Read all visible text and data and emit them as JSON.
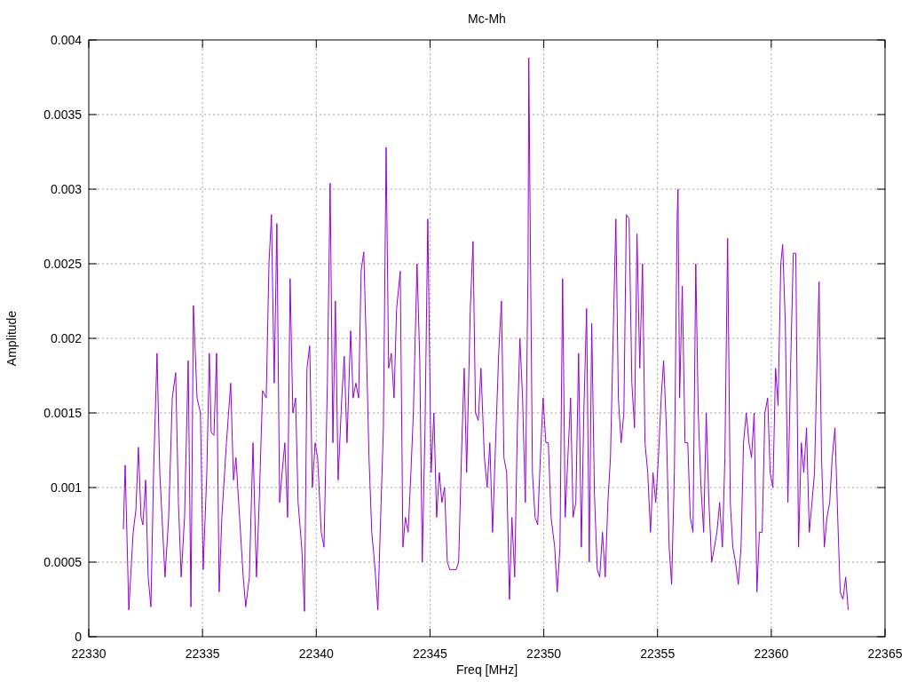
{
  "chart_data": {
    "type": "line",
    "title": "Mc-Mh",
    "grid": true,
    "xlabel": "Freq [MHz]",
    "ylabel": "Amplitude",
    "xlim": [
      22330,
      22365
    ],
    "ylim": [
      0,
      0.004
    ],
    "xticks": [
      22330,
      22335,
      22340,
      22345,
      22350,
      22355,
      22360,
      22365
    ],
    "yticks": [
      0,
      0.0005,
      0.001,
      0.0015,
      0.002,
      0.0025,
      0.003,
      0.0035,
      0.004
    ],
    "x": [
      22331.52,
      22331.6,
      22331.76,
      22331.95,
      22332.07,
      22332.18,
      22332.3,
      22332.38,
      22332.5,
      22332.61,
      22332.73,
      22332.85,
      22333.0,
      22333.12,
      22333.35,
      22333.51,
      22333.67,
      22333.82,
      22333.94,
      22334.06,
      22334.21,
      22334.37,
      22334.49,
      22334.6,
      22334.76,
      22334.91,
      22335.03,
      22335.19,
      22335.3,
      22335.38,
      22335.5,
      22335.62,
      22335.73,
      22335.85,
      22336.05,
      22336.24,
      22336.36,
      22336.47,
      22336.63,
      22336.79,
      22336.9,
      22337.06,
      22337.22,
      22337.37,
      22337.49,
      22337.64,
      22337.8,
      22337.92,
      22338.03,
      22338.15,
      22338.27,
      22338.39,
      22338.5,
      22338.62,
      22338.74,
      22338.85,
      22338.97,
      22339.09,
      22339.2,
      22339.36,
      22339.48,
      22339.59,
      22339.71,
      22339.83,
      22339.95,
      22340.06,
      22340.22,
      22340.34,
      22340.49,
      22340.61,
      22340.73,
      22340.84,
      22340.96,
      22341.12,
      22341.23,
      22341.35,
      22341.51,
      22341.62,
      22341.74,
      22341.86,
      22341.97,
      22342.09,
      22342.21,
      22342.32,
      22342.44,
      22342.56,
      22342.71,
      22342.83,
      22342.95,
      22343.07,
      22343.18,
      22343.3,
      22343.42,
      22343.53,
      22343.69,
      22343.81,
      22343.92,
      22344.04,
      22344.16,
      22344.27,
      22344.43,
      22344.55,
      22344.66,
      22344.78,
      22344.9,
      22345.05,
      22345.17,
      22345.29,
      22345.41,
      22345.52,
      22345.64,
      22345.76,
      22345.87,
      22345.99,
      22346.15,
      22346.26,
      22346.38,
      22346.5,
      22346.61,
      22346.77,
      22346.89,
      22347.0,
      22347.12,
      22347.24,
      22347.39,
      22347.51,
      22347.63,
      22347.75,
      22347.86,
      22348.02,
      22348.14,
      22348.25,
      22348.37,
      22348.49,
      22348.6,
      22348.72,
      22348.84,
      22348.95,
      22349.07,
      22349.19,
      22349.31,
      22349.34,
      22349.42,
      22349.5,
      22349.62,
      22349.73,
      22349.85,
      22349.97,
      22350.09,
      22350.2,
      22350.32,
      22350.48,
      22350.59,
      22350.71,
      22350.83,
      22350.94,
      22351.06,
      22351.18,
      22351.29,
      22351.41,
      22351.53,
      22351.65,
      22351.76,
      22351.88,
      22352.0,
      22352.11,
      22352.23,
      22352.35,
      22352.46,
      22352.58,
      22352.7,
      22352.82,
      22352.93,
      22353.05,
      22353.17,
      22353.28,
      22353.4,
      22353.52,
      22353.63,
      22353.75,
      22353.87,
      22353.99,
      22354.1,
      22354.22,
      22354.34,
      22354.45,
      22354.57,
      22354.69,
      22354.8,
      22354.92,
      22355.04,
      22355.16,
      22355.27,
      22355.39,
      22355.51,
      22355.62,
      22355.74,
      22355.86,
      22355.9,
      22355.97,
      22356.09,
      22356.21,
      22356.33,
      22356.44,
      22356.56,
      22356.68,
      22356.79,
      22356.91,
      22357.03,
      22357.14,
      22357.26,
      22357.38,
      22357.5,
      22357.61,
      22357.73,
      22357.85,
      22357.96,
      22358.08,
      22358.2,
      22358.31,
      22358.43,
      22358.55,
      22358.67,
      22358.78,
      22358.9,
      22359.02,
      22359.13,
      22359.25,
      22359.37,
      22359.48,
      22359.6,
      22359.72,
      22359.84,
      22359.95,
      22360.07,
      22360.19,
      22360.3,
      22360.42,
      22360.5,
      22360.62,
      22360.73,
      22360.85,
      22360.97,
      22361.08,
      22361.2,
      22361.32,
      22361.43,
      22361.55,
      22361.67,
      22361.79,
      22361.9,
      22362.02,
      22362.1,
      22362.21,
      22362.33,
      22362.45,
      22362.57,
      22362.68,
      22362.8,
      22362.92,
      22363.03,
      22363.15,
      22363.27,
      22363.38
    ],
    "series": [
      {
        "color": "#9400d3",
        "values": [
          0.00072,
          0.00115,
          0.00018,
          0.0007,
          0.00085,
          0.00127,
          0.0008,
          0.00075,
          0.00105,
          0.0004,
          0.0002,
          0.0011,
          0.0019,
          0.0011,
          0.0004,
          0.0008,
          0.0016,
          0.00177,
          0.0009,
          0.0004,
          0.0008,
          0.00185,
          0.0002,
          0.00222,
          0.0016,
          0.0015,
          0.00045,
          0.0011,
          0.0019,
          0.00137,
          0.00135,
          0.0019,
          0.0003,
          0.0008,
          0.0013,
          0.0017,
          0.00105,
          0.0012,
          0.0008,
          0.0004,
          0.0002,
          0.0004,
          0.0013,
          0.0004,
          0.0009,
          0.00165,
          0.0016,
          0.0025,
          0.00283,
          0.0017,
          0.00277,
          0.0009,
          0.0011,
          0.0013,
          0.0008,
          0.0024,
          0.0015,
          0.0016,
          0.0009,
          0.0006,
          0.00017,
          0.0018,
          0.00195,
          0.001,
          0.0013,
          0.0012,
          0.0007,
          0.0006,
          0.0017,
          0.00304,
          0.0013,
          0.00225,
          0.00105,
          0.0016,
          0.00188,
          0.0013,
          0.00205,
          0.0016,
          0.0017,
          0.0016,
          0.00245,
          0.00258,
          0.0019,
          0.0012,
          0.0007,
          0.0005,
          0.00018,
          0.0008,
          0.0014,
          0.00328,
          0.0018,
          0.0019,
          0.0016,
          0.0022,
          0.00245,
          0.0006,
          0.0008,
          0.0007,
          0.0011,
          0.0015,
          0.0025,
          0.00185,
          0.0005,
          0.0014,
          0.0028,
          0.0011,
          0.0015,
          0.0008,
          0.0011,
          0.0009,
          0.001,
          0.0005,
          0.00045,
          0.00045,
          0.00045,
          0.0005,
          0.0012,
          0.0018,
          0.0011,
          0.0022,
          0.00265,
          0.0015,
          0.00145,
          0.0018,
          0.0012,
          0.001,
          0.0013,
          0.0007,
          0.0012,
          0.0019,
          0.00225,
          0.0012,
          0.0011,
          0.00025,
          0.0008,
          0.0004,
          0.0014,
          0.002,
          0.0016,
          0.0009,
          0.0025,
          0.00388,
          0.0025,
          0.0011,
          0.0008,
          0.00075,
          0.0012,
          0.0016,
          0.0013,
          0.0013,
          0.0008,
          0.0006,
          0.0003,
          0.0006,
          0.0024,
          0.0008,
          0.0012,
          0.0016,
          0.0008,
          0.0009,
          0.0019,
          0.0006,
          0.0015,
          0.0022,
          0.0005,
          0.0021,
          0.00095,
          0.00045,
          0.0004,
          0.0007,
          0.0004,
          0.0009,
          0.0012,
          0.002,
          0.0028,
          0.0016,
          0.0013,
          0.0015,
          0.00283,
          0.0028,
          0.0017,
          0.0014,
          0.0027,
          0.0018,
          0.0025,
          0.0013,
          0.0011,
          0.0007,
          0.0011,
          0.0009,
          0.0012,
          0.0016,
          0.00185,
          0.0014,
          0.0006,
          0.00035,
          0.0011,
          0.0028,
          0.003,
          0.0016,
          0.00235,
          0.0013,
          0.0013,
          0.0008,
          0.0007,
          0.0025,
          0.0015,
          0.001,
          0.0007,
          0.0015,
          0.0009,
          0.0005,
          0.0006,
          0.0007,
          0.0009,
          0.0006,
          0.0012,
          0.00267,
          0.0009,
          0.0006,
          0.0005,
          0.00035,
          0.0006,
          0.0013,
          0.0015,
          0.0013,
          0.0012,
          0.0015,
          0.0003,
          0.0007,
          0.0007,
          0.0015,
          0.0016,
          0.0011,
          0.001,
          0.0018,
          0.00155,
          0.0025,
          0.00263,
          0.0021,
          0.0009,
          0.0018,
          0.00257,
          0.00257,
          0.0006,
          0.0013,
          0.0011,
          0.0014,
          0.0007,
          0.0009,
          0.0011,
          0.0019,
          0.00238,
          0.0012,
          0.0006,
          0.0008,
          0.0009,
          0.0012,
          0.0014,
          0.0008,
          0.0003,
          0.00025,
          0.0004,
          0.00018
        ]
      }
    ]
  }
}
